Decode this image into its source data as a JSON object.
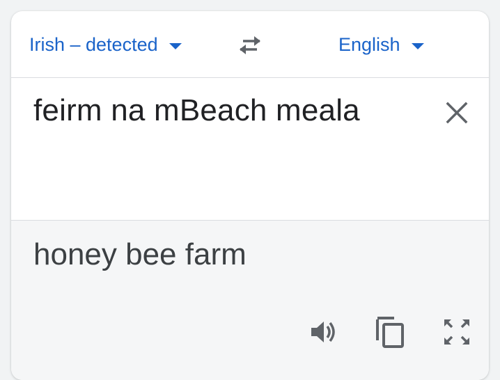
{
  "languages": {
    "source_label": "Irish – detected",
    "target_label": "English"
  },
  "icons": {
    "swap": "swap-arrows-icon",
    "clear": "close-icon",
    "listen": "speaker-icon",
    "copy": "copy-icon",
    "expand": "fullscreen-icon"
  },
  "input": {
    "source_text": "feirm na mBeach meala"
  },
  "output": {
    "translated_text": "honey bee farm"
  },
  "colors": {
    "accent": "#1a63c9",
    "icon": "#5f6368",
    "text": "#202124",
    "output_bg": "#f5f6f7"
  }
}
